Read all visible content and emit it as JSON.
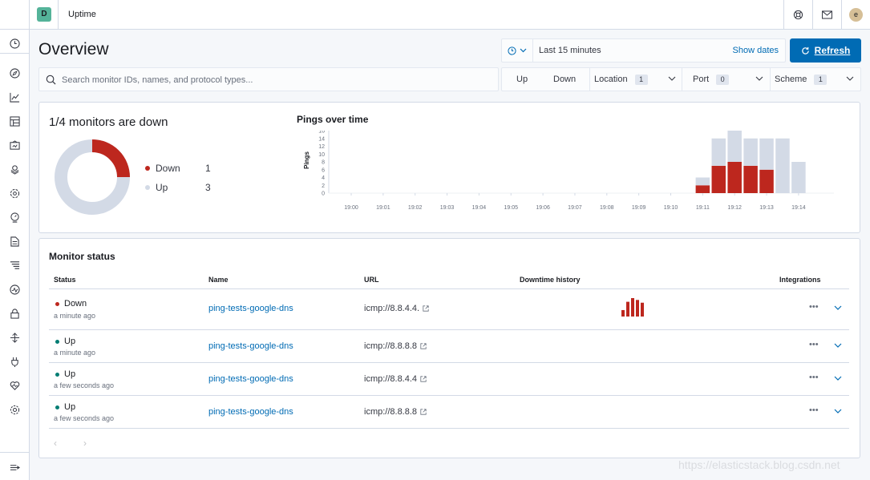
{
  "header": {
    "space_initial": "D",
    "app_title": "Uptime",
    "avatar_initial": "e",
    "icons": [
      "help-icon",
      "mail-icon"
    ]
  },
  "sidenav": {
    "icons": [
      "clock-icon",
      "compass-icon",
      "visualize-icon",
      "dashboard-icon",
      "canvas-icon",
      "maps-icon",
      "ml-icon",
      "metrics-icon",
      "logs-icon",
      "apm-icon",
      "uptime-icon",
      "siem-icon",
      "dev-tools-icon",
      "stack-monitoring-icon",
      "heartbeat-icon",
      "management-icon",
      "collapse-icon"
    ]
  },
  "page": {
    "title": "Overview"
  },
  "datepicker": {
    "value": "Last 15 minutes",
    "show_dates": "Show dates",
    "refresh_label": "Refresh"
  },
  "search": {
    "placeholder": "Search monitor IDs, names, and protocol types..."
  },
  "filters": {
    "up": "Up",
    "down": "Down",
    "location": {
      "label": "Location",
      "count": "1"
    },
    "port": {
      "label": "Port",
      "count": "0"
    },
    "scheme": {
      "label": "Scheme",
      "count": "1"
    }
  },
  "snapshot": {
    "title": "1/4 monitors are down",
    "down_label": "Down",
    "down_count": "1",
    "up_label": "Up",
    "up_count": "3",
    "down_fraction": 0.25
  },
  "colors": {
    "down": "#bd271e",
    "up_fill": "#d3dae6",
    "up_dot": "#017d73",
    "accent": "#006bb4"
  },
  "chart_data": {
    "type": "bar",
    "title": "Pings over time",
    "ylabel": "Pings",
    "xlabel": "",
    "ylim": [
      0,
      16
    ],
    "yticks": [
      "0",
      "2",
      "4",
      "6",
      "8",
      "10",
      "12",
      "14",
      "16"
    ],
    "xticks": [
      "19:00",
      "19:01",
      "19:02",
      "19:03",
      "19:04",
      "19:05",
      "19:06",
      "19:07",
      "19:08",
      "19:09",
      "19:10",
      "19:11",
      "19:12",
      "19:13",
      "19:14"
    ],
    "stacked": true,
    "categories": [
      "19:11:00",
      "19:11:30",
      "19:12:00",
      "19:12:30",
      "19:13:00",
      "19:13:30",
      "19:14:00"
    ],
    "series": [
      {
        "color": "#bd271e",
        "values": [
          2,
          7,
          8,
          7,
          6,
          0,
          0
        ]
      },
      {
        "color": "#d3dae6",
        "values": [
          2,
          7,
          8,
          7,
          8,
          14,
          8
        ]
      }
    ]
  },
  "monitor_status": {
    "title": "Monitor status",
    "columns": [
      "Status",
      "Name",
      "URL",
      "Downtime history",
      "Integrations"
    ],
    "rows": [
      {
        "status": "Down",
        "time": "a minute ago",
        "name": "ping-tests-google-dns",
        "url": "icmp://8.8.4.4.",
        "history": [
          0.35,
          0.8,
          1.0,
          0.9,
          0.75
        ]
      },
      {
        "status": "Up",
        "time": "a minute ago",
        "name": "ping-tests-google-dns",
        "url": "icmp://8.8.8.8",
        "history": []
      },
      {
        "status": "Up",
        "time": "a few seconds ago",
        "name": "ping-tests-google-dns",
        "url": "icmp://8.8.4.4",
        "history": []
      },
      {
        "status": "Up",
        "time": "a few seconds ago",
        "name": "ping-tests-google-dns",
        "url": "icmp://8.8.8.8",
        "history": []
      }
    ],
    "pagination": {
      "prev": "‹",
      "next": "›"
    }
  },
  "watermark": "https://elasticstack.blog.csdn.net"
}
